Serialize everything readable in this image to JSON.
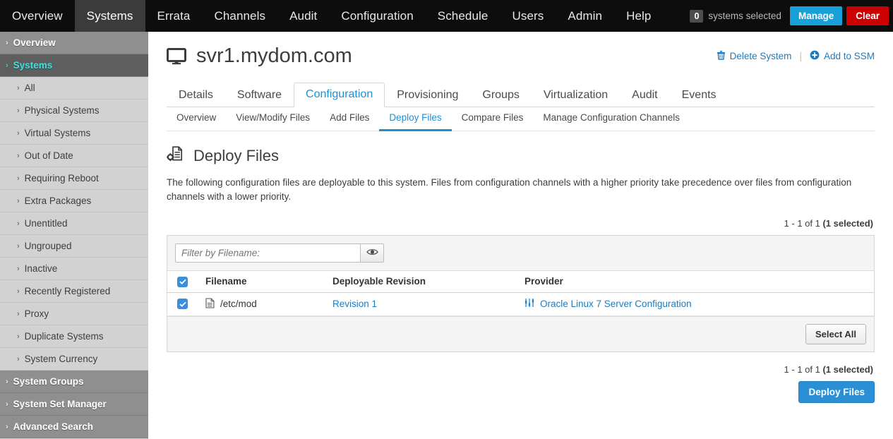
{
  "topnav": {
    "items": [
      {
        "label": "Overview",
        "active": false
      },
      {
        "label": "Systems",
        "active": true
      },
      {
        "label": "Errata",
        "active": false
      },
      {
        "label": "Channels",
        "active": false
      },
      {
        "label": "Audit",
        "active": false
      },
      {
        "label": "Configuration",
        "active": false
      },
      {
        "label": "Schedule",
        "active": false
      },
      {
        "label": "Users",
        "active": false
      },
      {
        "label": "Admin",
        "active": false
      },
      {
        "label": "Help",
        "active": false
      }
    ],
    "selected_count": "0",
    "selected_label": "systems selected",
    "manage_label": "Manage",
    "clear_label": "Clear",
    "manage_color": "#18a0d8",
    "clear_color": "#cc0000"
  },
  "sidebar": {
    "items": [
      {
        "label": "Overview",
        "level": 1,
        "active": false
      },
      {
        "label": "Systems",
        "level": 1,
        "active": true
      },
      {
        "label": "All",
        "level": 2,
        "active": false
      },
      {
        "label": "Physical Systems",
        "level": 2,
        "active": false
      },
      {
        "label": "Virtual Systems",
        "level": 2,
        "active": false
      },
      {
        "label": "Out of Date",
        "level": 2,
        "active": false
      },
      {
        "label": "Requiring Reboot",
        "level": 2,
        "active": false
      },
      {
        "label": "Extra Packages",
        "level": 2,
        "active": false
      },
      {
        "label": "Unentitled",
        "level": 2,
        "active": false
      },
      {
        "label": "Ungrouped",
        "level": 2,
        "active": false
      },
      {
        "label": "Inactive",
        "level": 2,
        "active": false
      },
      {
        "label": "Recently Registered",
        "level": 2,
        "active": false
      },
      {
        "label": "Proxy",
        "level": 2,
        "active": false
      },
      {
        "label": "Duplicate Systems",
        "level": 2,
        "active": false
      },
      {
        "label": "System Currency",
        "level": 2,
        "active": false
      },
      {
        "label": "System Groups",
        "level": 1,
        "active": false
      },
      {
        "label": "System Set Manager",
        "level": 1,
        "active": false
      },
      {
        "label": "Advanced Search",
        "level": 1,
        "active": false
      }
    ],
    "chevron": "›"
  },
  "header": {
    "title": "svr1.mydom.com",
    "icon": "monitor-icon",
    "actions": [
      {
        "label": "Delete System",
        "icon": "trash-icon"
      },
      {
        "label": "Add to SSM",
        "icon": "plus-circle-icon"
      }
    ],
    "separator": "|"
  },
  "tabs": [
    {
      "label": "Details",
      "active": false
    },
    {
      "label": "Software",
      "active": false
    },
    {
      "label": "Configuration",
      "active": true
    },
    {
      "label": "Provisioning",
      "active": false
    },
    {
      "label": "Groups",
      "active": false
    },
    {
      "label": "Virtualization",
      "active": false
    },
    {
      "label": "Audit",
      "active": false
    },
    {
      "label": "Events",
      "active": false
    }
  ],
  "subtabs": [
    {
      "label": "Overview",
      "active": false
    },
    {
      "label": "View/Modify Files",
      "active": false
    },
    {
      "label": "Add Files",
      "active": false
    },
    {
      "label": "Deploy Files",
      "active": true
    },
    {
      "label": "Compare Files",
      "active": false
    },
    {
      "label": "Manage Configuration Channels",
      "active": false
    }
  ],
  "section": {
    "title": "Deploy Files",
    "icon": "file-gear-icon",
    "description": "The following configuration files are deployable to this system. Files from configuration channels with a higher priority take precedence over files from configuration channels with a lower priority."
  },
  "pagination": {
    "range": "1 - 1 of 1 ",
    "selected": "(1 selected)"
  },
  "filter": {
    "placeholder": "Filter by Filename:",
    "value": "",
    "button_icon": "eye-icon"
  },
  "table": {
    "header_checkbox_checked": true,
    "columns": [
      "Filename",
      "Deployable Revision",
      "Provider"
    ],
    "rows": [
      {
        "checked": true,
        "filename": "/etc/mod",
        "filename_icon": "file-icon",
        "revision": "Revision 1",
        "provider": "Oracle Linux 7 Server Configuration",
        "provider_icon": "channel-sliders-icon"
      }
    ],
    "select_all_label": "Select All"
  },
  "footer": {
    "range": "1 - 1 of 1 ",
    "selected": "(1 selected)",
    "deploy_label": "Deploy Files",
    "deploy_color": "#2a8fd4"
  },
  "colors": {
    "link": "#1e7bbf",
    "active_blue": "#1f8fd1",
    "checkbox": "#3c8dde",
    "sidebar_bg": "#d2d2d2"
  }
}
